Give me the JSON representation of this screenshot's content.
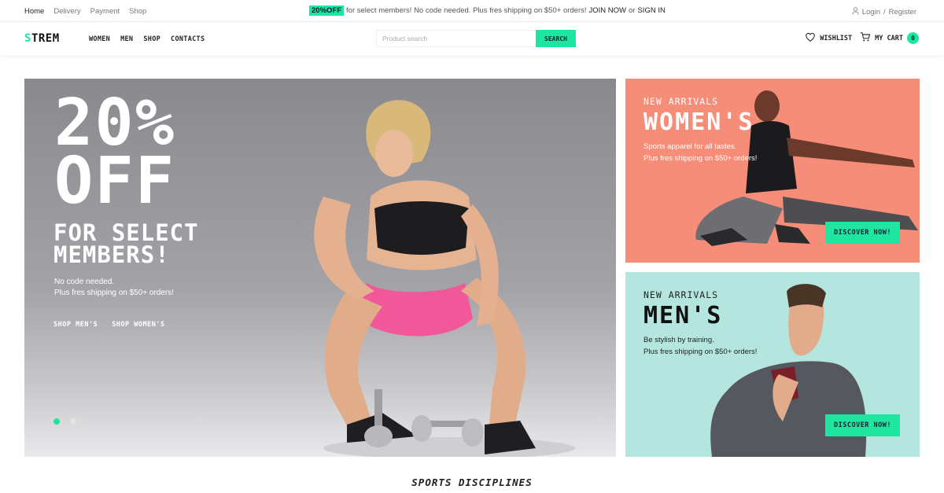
{
  "topbar": {
    "nav": [
      "Home",
      "Delivery",
      "Payment",
      "Shop"
    ],
    "promo_badge": "20%OFF",
    "promo_text": "for select members! No code needed. Plus fres shipping on $50+ orders!",
    "join": "JOIN NOW",
    "or": "or",
    "signin": "SIGN IN",
    "login": "Login",
    "sep": "/",
    "register": "Register"
  },
  "header": {
    "logo_accent": "S",
    "logo_rest": "TREM",
    "nav": [
      "WOMEN",
      "MEN",
      "SHOP",
      "CONTACTS"
    ],
    "search_placeholder": "Product search",
    "search_button": "SEARCH",
    "wishlist": "WISHLIST",
    "cart": "MY CART",
    "cart_count": "0"
  },
  "hero": {
    "line1": "20%",
    "line2": "OFF",
    "sub1": "FOR SELECT",
    "sub2": "MEMBERS!",
    "desc1": "No code needed.",
    "desc2": "Plus fres shipping on $50+ orders!",
    "link_men": "SHOP MEN'S",
    "link_women": "SHOP WOMEN'S",
    "slides": 2,
    "active_slide": 1
  },
  "womens": {
    "eyebrow": "NEW ARRIVALS",
    "title": "WOMEN'S",
    "desc1": "Sports apparel for all tastes.",
    "desc2": "Plus fres shipping on $50+ orders!",
    "button": "DISCOVER NOW!"
  },
  "mens": {
    "eyebrow": "NEW ARRIVALS",
    "title": "MEN'S",
    "desc1": "Be stylish by training.",
    "desc2": "Plus fres shipping on $50+ orders!",
    "button": "DISCOVER NOW!"
  },
  "section_title": "SPORTS DISCIPLINES",
  "colors": {
    "accent": "#1ee6a0",
    "womens_bg": "#f58d78",
    "mens_bg": "#b4e6df",
    "hero_bg": "#9a999e"
  }
}
